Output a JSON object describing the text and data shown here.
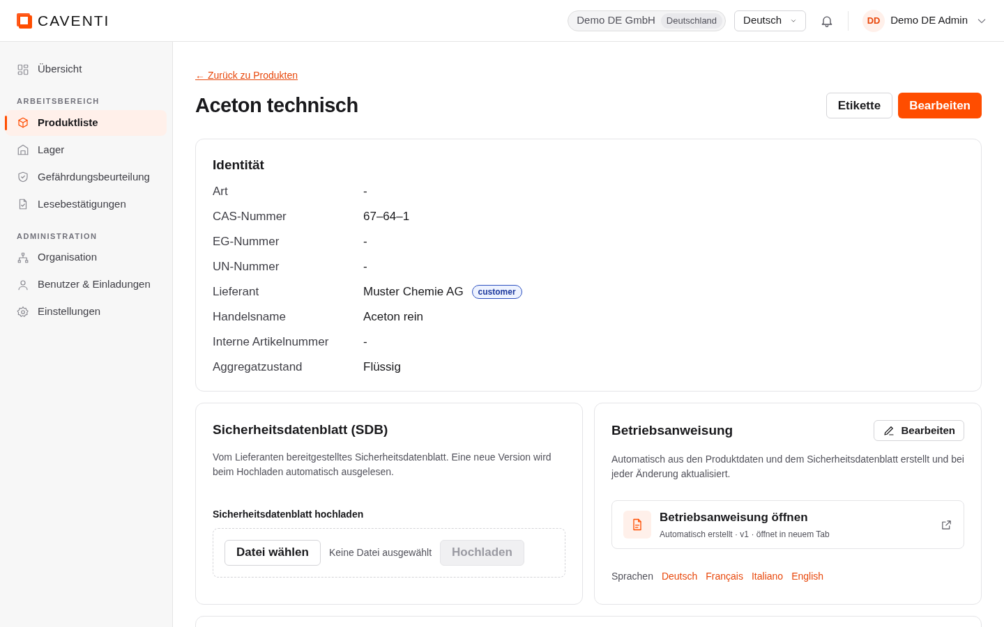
{
  "header": {
    "brand": "CAVENTI",
    "org": {
      "name": "Demo DE GmbH",
      "country": "Deutschland"
    },
    "language": "Deutsch",
    "user": {
      "initials": "DD",
      "name": "Demo DE Admin"
    }
  },
  "sidebar": {
    "groups": [
      {
        "items": [
          {
            "label": "Übersicht",
            "selected": false
          }
        ]
      },
      {
        "heading": "ARBEITSBEREICH",
        "items": [
          {
            "label": "Produktliste",
            "selected": true
          },
          {
            "label": "Lager",
            "selected": false
          },
          {
            "label": "Gefährdungsbeurteilung",
            "selected": false
          },
          {
            "label": "Lesebestätigungen",
            "selected": false
          }
        ]
      },
      {
        "heading": "ADMINISTRATION",
        "items": [
          {
            "label": "Organisation",
            "selected": false
          },
          {
            "label": "Benutzer & Einladungen",
            "selected": false
          },
          {
            "label": "Einstellungen",
            "selected": false
          }
        ]
      }
    ]
  },
  "back_link": "← Zurück zu Produkten",
  "title": "Aceton technisch",
  "actions": [
    "Etikette",
    "Bearbeiten"
  ],
  "identity": {
    "title": "Identität",
    "rows": [
      {
        "label": "Art",
        "value": "-"
      },
      {
        "label": "CAS-Nummer",
        "value": "67–64–1"
      },
      {
        "label": "EG-Nummer",
        "value": "-"
      },
      {
        "label": "UN-Nummer",
        "value": "-"
      },
      {
        "label": "Lieferant",
        "value": "Muster Chemie AG",
        "badge": "customer"
      },
      {
        "label": "Handelsname",
        "value": "Aceton rein"
      },
      {
        "label": "Interne Artikelnummer",
        "value": "-"
      },
      {
        "label": "Aggregatzustand",
        "value": "Flüssig"
      }
    ]
  },
  "sdb": {
    "title": "Sicherheitsdatenblatt (SDB)",
    "description": "Vom Lieferanten bereitgestelltes Sicherheitsdatenblatt. Eine neue Version wird beim Hochladen automatisch ausgelesen.",
    "upload_label": "Sicherheitsdatenblatt hochladen",
    "choose_button": "Datei wählen",
    "file_status": "Keine Datei ausgewählt",
    "upload_button": {
      "label": "Hochladen",
      "disabled": true
    }
  },
  "instruction": {
    "title": "Betriebsanweisung",
    "edit_button": "Bearbeiten",
    "description": "Automatisch aus den Produktdaten und dem Sicherheitsdatenblatt erstellt und bei jeder Änderung aktualisiert.",
    "document": {
      "title": "Betriebsanweisung öffnen",
      "subtitle": "Automatisch erstellt · v1 · öffnet in neuem Tab"
    },
    "languages_label": "Sprachen",
    "languages": [
      "Deutsch",
      "Français",
      "Italiano",
      "English"
    ]
  }
}
